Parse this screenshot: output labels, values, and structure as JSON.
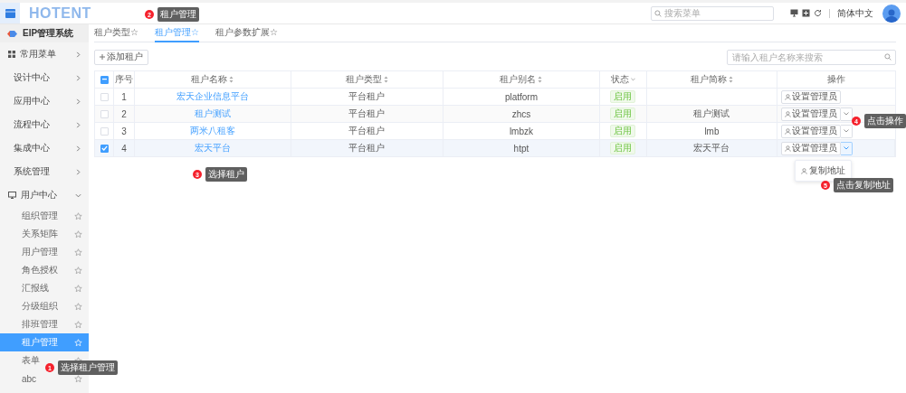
{
  "header": {
    "logo": "HOTENT",
    "search_placeholder": "搜索菜单",
    "language": "简体中文"
  },
  "sidebar": {
    "system": "EIP管理系统",
    "groups": [
      {
        "label": "常用菜单",
        "kind": "favorites",
        "expanded": false
      },
      {
        "label": "设计中心",
        "kind": "plain",
        "expanded": false
      },
      {
        "label": "应用中心",
        "kind": "plain",
        "expanded": false
      },
      {
        "label": "流程中心",
        "kind": "plain",
        "expanded": false
      },
      {
        "label": "集成中心",
        "kind": "plain",
        "expanded": false
      },
      {
        "label": "系统管理",
        "kind": "plain",
        "expanded": false
      },
      {
        "label": "用户中心",
        "kind": "user",
        "expanded": true,
        "children": [
          {
            "label": "组织管理",
            "selected": false
          },
          {
            "label": "关系矩阵",
            "selected": false
          },
          {
            "label": "用户管理",
            "selected": false
          },
          {
            "label": "角色授权",
            "selected": false
          },
          {
            "label": "汇报线",
            "selected": false
          },
          {
            "label": "分级组织",
            "selected": false
          },
          {
            "label": "排班管理",
            "selected": false
          },
          {
            "label": "租户管理",
            "selected": true
          },
          {
            "label": "表单",
            "selected": false
          },
          {
            "label": "abc",
            "selected": false
          }
        ]
      }
    ]
  },
  "tabs": [
    {
      "label": "租户类型☆",
      "selected": false
    },
    {
      "label": "租户管理☆",
      "selected": true
    },
    {
      "label": "租户参数扩展☆",
      "selected": false
    }
  ],
  "toolbar": {
    "add_button": "添加租户",
    "search_placeholder": "请输入租户名称来搜索"
  },
  "table": {
    "header_checkbox_indeterminate": true,
    "columns": [
      {
        "label": "序号",
        "kind": "plain"
      },
      {
        "label": "租户名称",
        "kind": "sortable"
      },
      {
        "label": "租户类型",
        "kind": "sortable"
      },
      {
        "label": "租户别名",
        "kind": "sortable"
      },
      {
        "label": "状态",
        "kind": "filter"
      },
      {
        "label": "租户简称",
        "kind": "sortable"
      },
      {
        "label": "操作",
        "kind": "plain"
      }
    ],
    "rows": [
      {
        "checked": false,
        "index": "1",
        "name": "宏天企业信息平台",
        "type": "平台租户",
        "alias": "platform",
        "status": "启用",
        "short_name": "",
        "action": "设置管理员",
        "has_dropdown": false
      },
      {
        "checked": false,
        "index": "2",
        "name": "租户测试",
        "type": "平台租户",
        "alias": "zhcs",
        "status": "启用",
        "short_name": "租户测试",
        "action": "设置管理员",
        "has_dropdown": true
      },
      {
        "checked": false,
        "index": "3",
        "name": "两米八租客",
        "type": "平台租户",
        "alias": "lmbzk",
        "status": "启用",
        "short_name": "lmb",
        "action": "设置管理员",
        "has_dropdown": true
      },
      {
        "checked": true,
        "index": "4",
        "name": "宏天平台",
        "type": "平台租户",
        "alias": "htpt",
        "status": "启用",
        "short_name": "宏天平台",
        "action": "设置管理员",
        "has_dropdown": true,
        "menu": [
          "复制地址"
        ]
      }
    ]
  },
  "callouts": [
    {
      "number": "1",
      "text": "选择租户管理"
    },
    {
      "number": "2",
      "text": "租户管理"
    },
    {
      "number": "3",
      "text": "选择租户"
    },
    {
      "number": "4",
      "text": "点击操作"
    },
    {
      "number": "5",
      "text": "点击复制地址"
    }
  ]
}
